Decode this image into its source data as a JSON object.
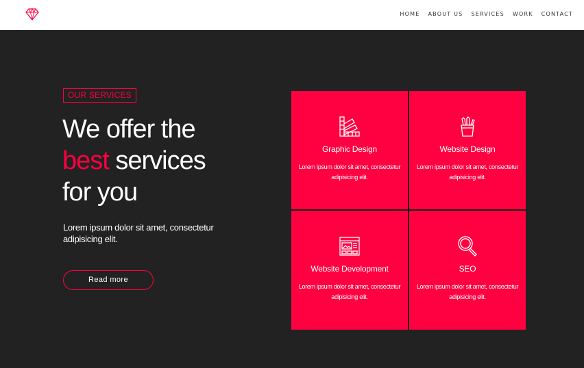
{
  "header": {
    "logo_icon": "diamond-icon",
    "nav": [
      "HOME",
      "ABOUT US",
      "SERVICES",
      "WORK",
      "CONTACT"
    ]
  },
  "hero": {
    "eyebrow": "OUR SERVICES",
    "headline": {
      "line1": "We offer the",
      "accent": "best",
      "line2_rest": " services",
      "line3": "for you"
    },
    "lead": "Lorem ipsum dolor sit amet, consectetur adipisicing elit.",
    "cta": "Read more"
  },
  "services": [
    {
      "icon": "color-swatch-icon",
      "title": "Graphic Design",
      "desc": "Lorem ipsum dolor sit amet, consectetur adipisicing elit."
    },
    {
      "icon": "pencil-cup-icon",
      "title": "Website Design",
      "desc": "Lorem ipsum dolor sit amet, consectetur adipisicing elit."
    },
    {
      "icon": "web-layout-icon",
      "title": "Website Development",
      "desc": "Lorem ipsum dolor sit amet, consectetur adipisicing elit."
    },
    {
      "icon": "magnifier-icon",
      "title": "SEO",
      "desc": "Lorem ipsum dolor sit amet, consectetur adipisicing elit."
    }
  ],
  "colors": {
    "accent": "#ff0040",
    "background": "#222222",
    "header_bg": "#ffffff"
  }
}
